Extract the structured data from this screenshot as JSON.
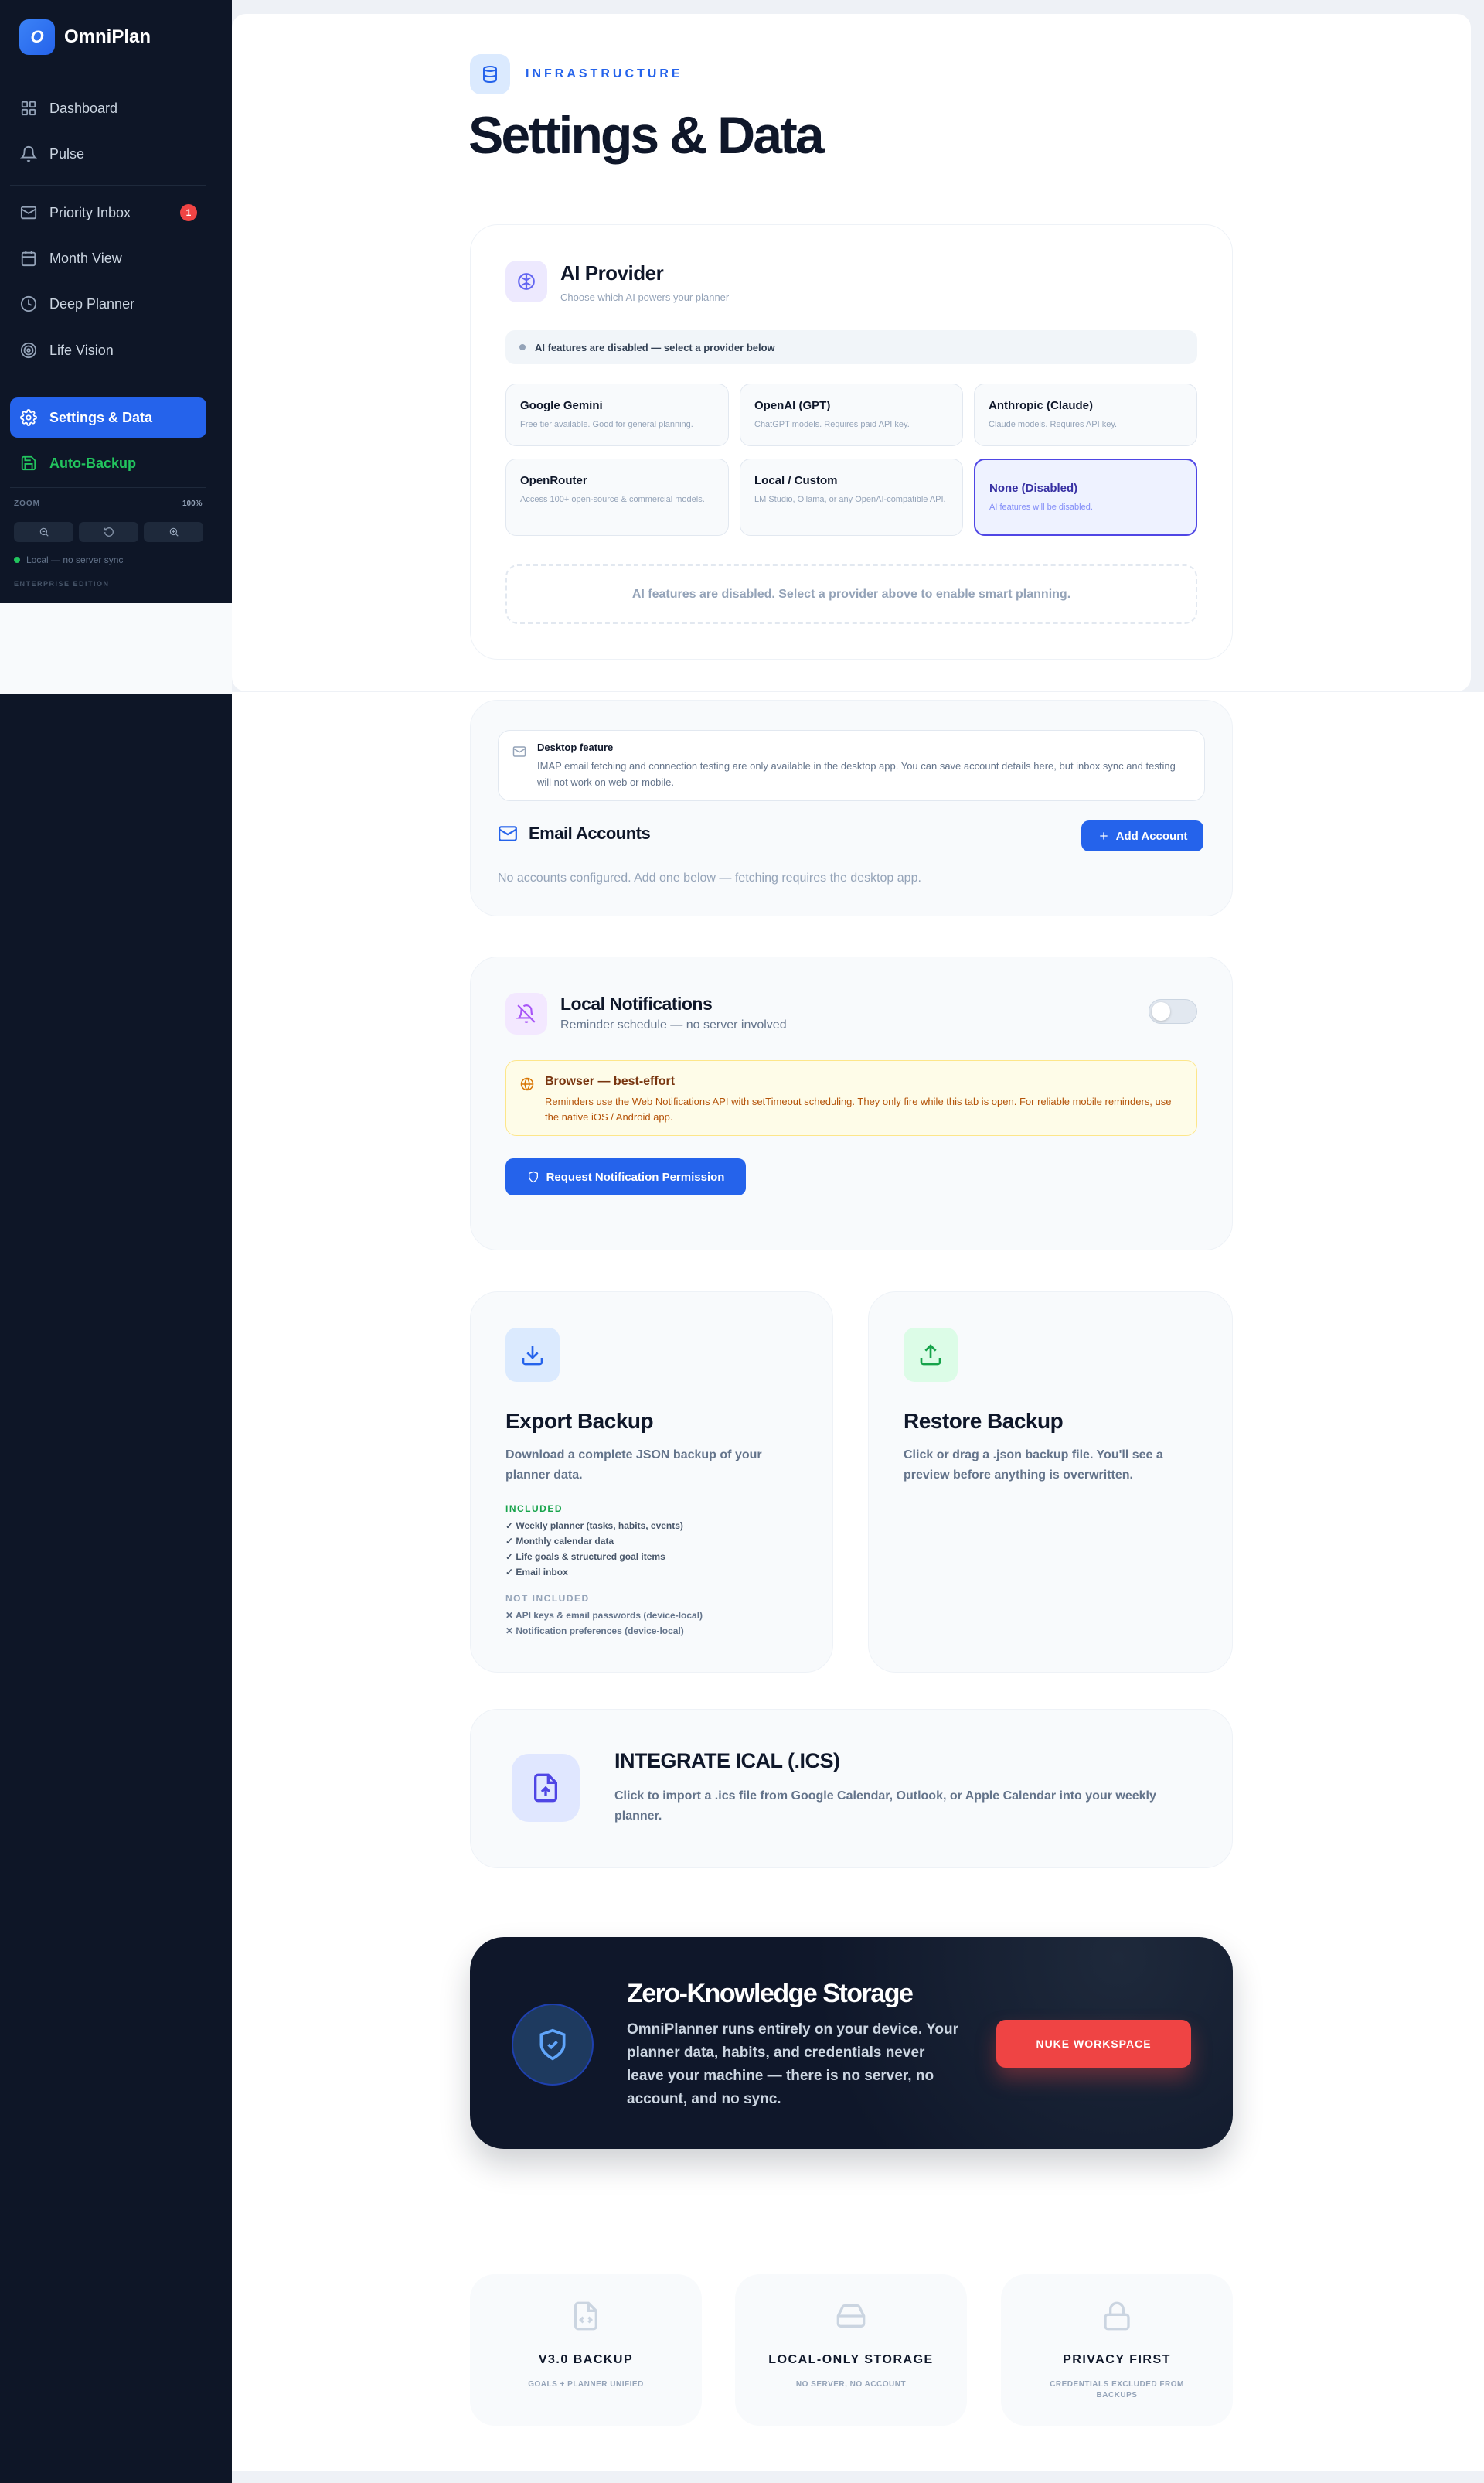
{
  "sidebar": {
    "brand_initial": "O",
    "brand_name": "OmniPlan",
    "nav": [
      {
        "label": "Dashboard",
        "icon": "grid-icon"
      },
      {
        "label": "Pulse",
        "icon": "bell-icon"
      },
      {
        "label": "Priority Inbox",
        "icon": "mail-icon",
        "badge": "1"
      },
      {
        "label": "Month View",
        "icon": "calendar-icon"
      },
      {
        "label": "Deep Planner",
        "icon": "clock-icon"
      },
      {
        "label": "Life Vision",
        "icon": "target-icon"
      },
      {
        "label": "Settings & Data",
        "icon": "gear-icon",
        "active": true
      },
      {
        "label": "Auto-Backup",
        "icon": "save-icon"
      }
    ],
    "zoom_label": "ZOOM",
    "zoom_value": "100%",
    "sync_status": "Local — no server sync",
    "edition": "ENTERPRISE EDITION"
  },
  "header": {
    "eyebrow": "INFRASTRUCTURE",
    "title": "Settings & Data"
  },
  "ai_provider": {
    "title": "AI Provider",
    "subtitle": "Choose which AI powers your planner",
    "status": "AI features are disabled — select a provider below",
    "providers": [
      {
        "name": "Google Gemini",
        "desc": "Free tier available. Good for general planning."
      },
      {
        "name": "OpenAI (GPT)",
        "desc": "ChatGPT models. Requires paid API key."
      },
      {
        "name": "Anthropic (Claude)",
        "desc": "Claude models. Requires API key."
      },
      {
        "name": "OpenRouter",
        "desc": "Access 100+ open-source & commercial models."
      },
      {
        "name": "Local / Custom",
        "desc": "LM Studio, Ollama, or any OpenAI-compatible API."
      },
      {
        "name": "None (Disabled)",
        "desc": "AI features will be disabled.",
        "selected": true
      }
    ],
    "disabled_note": "AI features are disabled. Select a provider above to enable smart planning."
  },
  "email": {
    "desktop_title": "Desktop feature",
    "desktop_desc": "IMAP email fetching and connection testing are only available in the desktop app. You can save account details here, but inbox sync and testing will not work on web or mobile.",
    "title": "Email Accounts",
    "add_button": "Add Account",
    "empty": "No accounts configured. Add one below — fetching requires the desktop app."
  },
  "notifications": {
    "title": "Local Notifications",
    "subtitle": "Reminder schedule — no server involved",
    "enabled": false,
    "warn_title": "Browser — best-effort",
    "warn_desc": "Reminders use the Web Notifications API with setTimeout scheduling. They only fire while this tab is open. For reliable mobile reminders, use the native iOS / Android app.",
    "request_button": "Request Notification Permission"
  },
  "export": {
    "title": "Export Backup",
    "desc": "Download a complete JSON backup of your planner data.",
    "included_label": "INCLUDED",
    "included": [
      "✓ Weekly planner (tasks, habits, events)",
      "✓ Monthly calendar data",
      "✓ Life goals & structured goal items",
      "✓ Email inbox"
    ],
    "not_included_label": "NOT INCLUDED",
    "not_included": [
      "✕ API keys & email passwords (device-local)",
      "✕ Notification preferences (device-local)"
    ]
  },
  "restore": {
    "title": "Restore Backup",
    "desc": "Click or drag a .json backup file. You'll see a preview before anything is overwritten."
  },
  "ical": {
    "title": "INTEGRATE ICAL (.ICS)",
    "desc": "Click to import a .ics file from Google Calendar, Outlook, or Apple Calendar into your weekly planner."
  },
  "zero_knowledge": {
    "title": "Zero-Knowledge Storage",
    "desc": "OmniPlanner runs entirely on your device. Your planner data, habits, and credentials never leave your machine — there is no server, no account, and no sync.",
    "nuke_button": "NUKE WORKSPACE"
  },
  "features": [
    {
      "title": "V3.0 BACKUP",
      "desc": "GOALS + PLANNER UNIFIED",
      "icon": "file-code-icon"
    },
    {
      "title": "LOCAL-ONLY STORAGE",
      "desc": "NO SERVER, NO ACCOUNT",
      "icon": "hard-drive-icon"
    },
    {
      "title": "PRIVACY FIRST",
      "desc": "CREDENTIALS EXCLUDED FROM BACKUPS",
      "icon": "lock-icon"
    }
  ],
  "colors": {
    "sidebar_bg": "#0e1627",
    "accent": "#2563eb",
    "danger": "#ef4444",
    "success": "#22c55e",
    "selected_provider": "#4f46e5"
  }
}
